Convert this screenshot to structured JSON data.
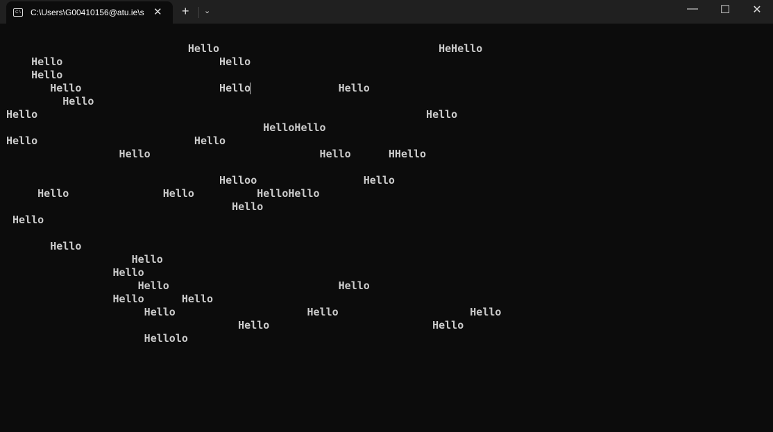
{
  "tab": {
    "title": "C:\\Users\\G00410156@atu.ie\\s",
    "icon": "terminal-icon",
    "close": "✕"
  },
  "toolbar": {
    "new_tab": "+",
    "dropdown": "⌄"
  },
  "window": {
    "minimize": "—",
    "maximize": "☐",
    "close": "✕"
  },
  "terminal": {
    "lines": [
      "",
      "                             Hello                                   HeHello",
      "    Hello                         Hello",
      "    Hello",
      "       Hello                      Hello              Hello",
      "         Hello",
      "Hello                                                              Hello",
      "                                         HelloHello",
      "Hello                         Hello",
      "                  Hello                           Hello      HHello",
      "",
      "                                  Helloo                 Hello",
      "     Hello               Hello          HelloHello",
      "                                    Hello",
      " Hello",
      "",
      "       Hello",
      "                    Hello",
      "                 Hello",
      "                     Hello                           Hello",
      "                 Hello      Hello",
      "                      Hello                     Hello                     Hello",
      "                                     Hello                          Hello",
      "                      Hellolo"
    ]
  }
}
